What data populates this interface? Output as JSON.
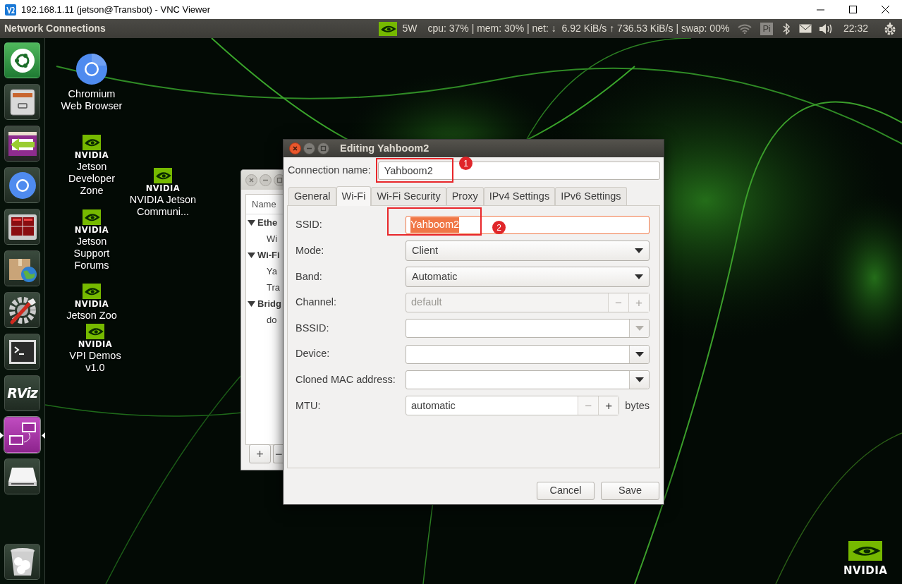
{
  "vnc_window": {
    "title": "192.168.1.11 (jetson@Transbot) - VNC Viewer"
  },
  "top_panel": {
    "app_title": "Network Connections",
    "power": "5W",
    "stats": "cpu: 37% | mem: 30% | net: ↓  6.92 KiB/s ↑ 736.53 KiB/s | swap: 00%",
    "keyboard": "Pi",
    "clock": "22:32"
  },
  "launcher": {
    "items": [
      {
        "kind": "dash",
        "running": false
      },
      {
        "kind": "files",
        "running": false
      },
      {
        "kind": "migrate",
        "running": false
      },
      {
        "kind": "chromium",
        "running": false
      },
      {
        "kind": "tiles",
        "running": false
      },
      {
        "kind": "package",
        "running": false
      },
      {
        "kind": "settings",
        "running": false
      },
      {
        "kind": "terminal",
        "running": false
      },
      {
        "kind": "rviz",
        "label": "RViz",
        "running": false
      },
      {
        "kind": "remote",
        "running": true
      },
      {
        "kind": "drive",
        "running": false
      },
      {
        "kind": "trash",
        "running": false
      }
    ]
  },
  "desktop_icons": [
    {
      "kind": "chromium",
      "label": "Chromium Web Browser"
    },
    {
      "kind": "nvidia",
      "logo_text": "NVIDIA",
      "label": "Jetson Developer Zone"
    },
    {
      "kind": "nvidia",
      "logo_text": "NVIDIA",
      "label": "Jetson Support Forums"
    },
    {
      "kind": "nvidia",
      "logo_text": "NVIDIA",
      "label": "Jetson Zoo"
    },
    {
      "kind": "nvidia",
      "logo_text": "NVIDIA",
      "label": "VPI Demos v1.0"
    },
    {
      "kind": "nvidia",
      "logo_text": "NVIDIA",
      "label": "NVIDIA Jetson Communi..."
    }
  ],
  "background_window": {
    "column": "Name",
    "items": [
      {
        "label": "Ethe",
        "expanded": true,
        "children": [
          {
            "label": "Wi"
          }
        ]
      },
      {
        "label": "Wi-Fi",
        "expanded": true,
        "children": [
          {
            "label": "Ya"
          },
          {
            "label": "Tra"
          }
        ]
      },
      {
        "label": "Bridg",
        "expanded": true,
        "children": [
          {
            "label": "do"
          }
        ]
      }
    ],
    "buttons": [
      "+",
      "−"
    ]
  },
  "dialog": {
    "title": "Editing Yahboom2",
    "connection_name": {
      "label": "Connection name:",
      "value": "Yahboom2"
    },
    "tabs": [
      {
        "label": "General",
        "selected": false
      },
      {
        "label": "Wi-Fi",
        "selected": true
      },
      {
        "label": "Wi-Fi Security",
        "selected": false
      },
      {
        "label": "Proxy",
        "selected": false
      },
      {
        "label": "IPv4 Settings",
        "selected": false
      },
      {
        "label": "IPv6 Settings",
        "selected": false
      }
    ],
    "fields": [
      {
        "kind": "entry",
        "label": "SSID:",
        "value": "Yahboom2",
        "focused": true
      },
      {
        "kind": "combo",
        "label": "Mode:",
        "value": "Client",
        "focused": false
      },
      {
        "kind": "combo",
        "label": "Band:",
        "value": "Automatic",
        "focused": false
      },
      {
        "kind": "spin",
        "label": "Channel:",
        "value": "default",
        "disabled": true,
        "buttons": [
          {
            "label": "−",
            "disabled": true
          },
          {
            "label": "+",
            "disabled": true
          }
        ],
        "focused": false
      },
      {
        "kind": "combo-entry",
        "label": "BSSID:",
        "menu_enabled": false,
        "focused": false
      },
      {
        "kind": "combo-entry",
        "label": "Device:",
        "menu_enabled": true,
        "focused": false
      },
      {
        "kind": "combo-entry",
        "label": "Cloned MAC address:",
        "menu_enabled": true,
        "focused": false
      },
      {
        "kind": "spin",
        "label": "MTU:",
        "value": "automatic",
        "disabled": false,
        "buttons": [
          {
            "label": "−",
            "disabled": true
          },
          {
            "label": "+",
            "disabled": false
          }
        ],
        "unit": "bytes",
        "focused": false
      }
    ],
    "buttons": [
      "Cancel",
      "Save"
    ]
  },
  "annotations": [
    {
      "label": "1"
    },
    {
      "label": "2"
    }
  ],
  "corner_logo": {
    "text": "NVIDIA"
  }
}
